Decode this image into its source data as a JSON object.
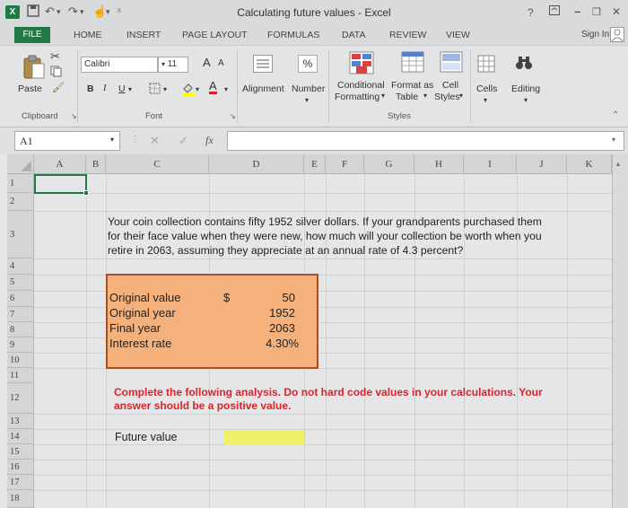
{
  "window": {
    "title": "Calculating future values - Excel",
    "help": "?",
    "minimize": "–",
    "restore": "❐",
    "close": "✕"
  },
  "tabs": {
    "file": "FILE",
    "items": [
      "HOME",
      "INSERT",
      "PAGE LAYOUT",
      "FORMULAS",
      "DATA",
      "REVIEW",
      "VIEW"
    ],
    "sign_in": "Sign In"
  },
  "ribbon": {
    "paste": "Paste",
    "clipboard": "Clipboard",
    "font_name": "Calibri",
    "font_size": "11",
    "grow": "A",
    "shrink": "A",
    "bold": "B",
    "italic": "I",
    "underline": "U",
    "font_group": "Font",
    "alignment": "Alignment",
    "number": "Number",
    "percent": "%",
    "conditional_1": "Conditional",
    "conditional_2": "Formatting",
    "format_table_1": "Format as",
    "format_table_2": "Table",
    "cell_styles_1": "Cell",
    "cell_styles_2": "Styles",
    "styles_group": "Styles",
    "cells": "Cells",
    "editing": "Editing"
  },
  "formula_bar": {
    "name_box": "A1",
    "fx": "fx",
    "formula": ""
  },
  "columns": [
    "A",
    "B",
    "C",
    "D",
    "E",
    "F",
    "G",
    "H",
    "I",
    "J",
    "K"
  ],
  "rows": [
    "1",
    "2",
    "3",
    "4",
    "5",
    "6",
    "7",
    "8",
    "9",
    "10",
    "11",
    "12",
    "13",
    "14",
    "15",
    "16",
    "17",
    "18"
  ],
  "sheet": {
    "problem_line_1": "Your coin collection contains fifty 1952 silver dollars. If your grandparents purchased them",
    "problem_line_2": "for their face value when they were new, how much will your collection be worth when you",
    "problem_line_3": "retire in 2063, assuming they appreciate at an annual rate of 4.3 percent?",
    "inputs": [
      {
        "label": "Original value",
        "symbol": "$",
        "value": "50"
      },
      {
        "label": "Original year",
        "symbol": "",
        "value": "1952"
      },
      {
        "label": "Final year",
        "symbol": "",
        "value": "2063"
      },
      {
        "label": "Interest rate",
        "symbol": "",
        "value": "4.30%"
      }
    ],
    "instruction_line_1": "Complete the following analysis. Do not hard code values in your calculations. Your",
    "instruction_line_2": "answer should be a positive value.",
    "future_value_label": "Future value",
    "future_value": ""
  },
  "colors": {
    "excel_green": "#1f7a43",
    "input_fill": "#f5b17b",
    "input_border": "#a4502a",
    "instruction_red": "#d9252b",
    "answer_fill": "#f1f169"
  }
}
